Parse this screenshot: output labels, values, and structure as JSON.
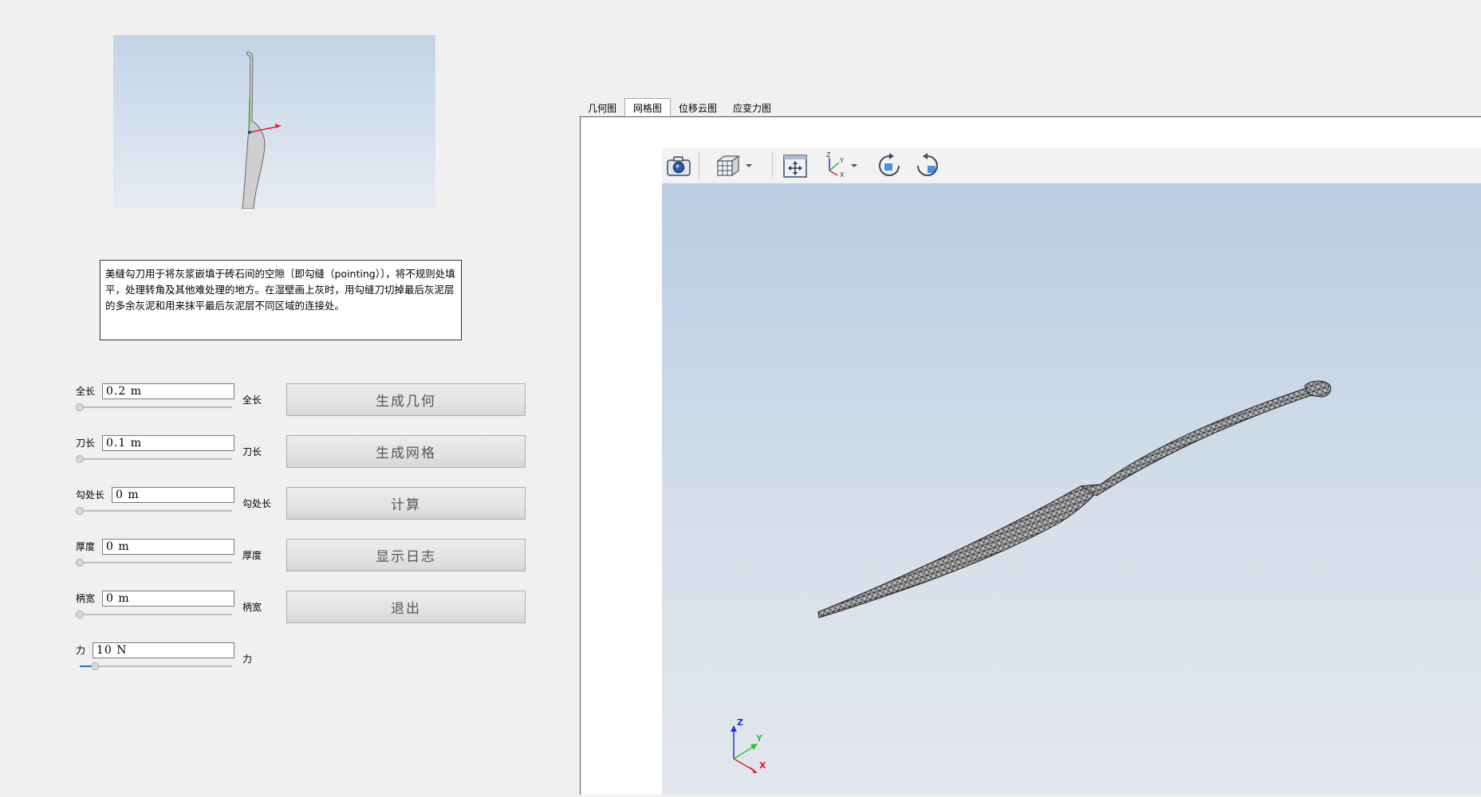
{
  "description": "美缝勾刀用于将灰浆嵌填于砖石间的空隙〔即勾缝（pointing）〕，将不规则处填平，处理转角及其他难处理的地方。在湿壁画上灰时，用勾缝刀切掉最后灰泥层的多余灰泥和用来抹平最后灰泥层不同区域的连接处。",
  "params": [
    {
      "label": "全长",
      "value": "0.2 m",
      "side_label": "全长",
      "slider": 0.0
    },
    {
      "label": "刀长",
      "value": "0.1 m",
      "side_label": "刀长",
      "slider": 0.0
    },
    {
      "label": "勾处长",
      "value": "0 m",
      "side_label": "勾处长",
      "slider": 0.0
    },
    {
      "label": "厚度",
      "value": "0 m",
      "side_label": "厚度",
      "slider": 0.0
    },
    {
      "label": "柄宽",
      "value": "0 m",
      "side_label": "柄宽",
      "slider": 0.0
    },
    {
      "label": "力",
      "value": "10 N",
      "side_label": "力",
      "slider": 0.1
    }
  ],
  "buttons": {
    "generate_geometry": "生成几何",
    "generate_mesh": "生成网格",
    "compute": "计算",
    "show_log": "显示日志",
    "exit": "退出"
  },
  "tabs": [
    {
      "label": "几何图",
      "active": false
    },
    {
      "label": "网格图",
      "active": true
    },
    {
      "label": "位移云图",
      "active": false
    },
    {
      "label": "应变力图",
      "active": false
    }
  ],
  "toolbar": {
    "icons": [
      "camera-icon",
      "view-cube-icon",
      "fit-view-icon",
      "axes-orientation-icon",
      "rotate-cw-icon",
      "rotate-ccw-icon"
    ]
  },
  "axes": {
    "x": "X",
    "y": "Y",
    "z": "Z"
  },
  "colors": {
    "axis_x": "#e0202b",
    "axis_y": "#2fbf3a",
    "axis_z": "#1d35d8",
    "accent": "#2c6dbd"
  }
}
